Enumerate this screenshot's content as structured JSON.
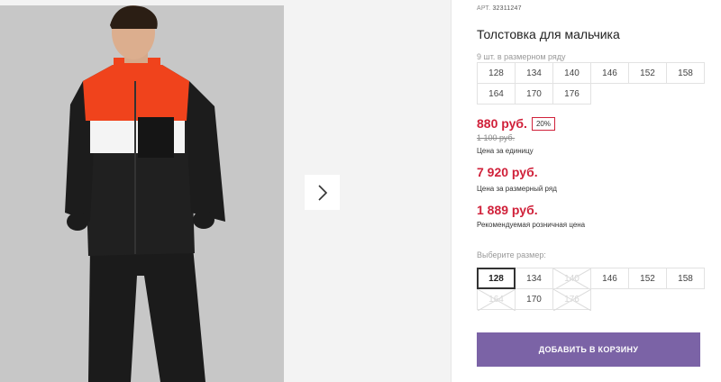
{
  "product": {
    "article_label": "АРТ.",
    "article_value": "32311247",
    "title": "Толстовка для мальчика",
    "pack_label": "9 шт. в размерном ряду"
  },
  "pack_sizes": [
    "128",
    "134",
    "140",
    "146",
    "152",
    "158",
    "164",
    "170",
    "176"
  ],
  "prices": {
    "unit_price": "880 руб.",
    "discount_badge": "20%",
    "old_price": "1 100 руб.",
    "unit_caption": "Цена за единицу",
    "pack_price": "7 920 руб.",
    "pack_caption": "Цена за размерный ряд",
    "retail_price": "1 889 руб.",
    "retail_caption": "Рекомендуемая розничная цена"
  },
  "size_selector": {
    "label": "Выберите размер:",
    "sizes": [
      {
        "label": "128",
        "state": "selected"
      },
      {
        "label": "134",
        "state": "available"
      },
      {
        "label": "140",
        "state": "unavailable"
      },
      {
        "label": "146",
        "state": "available"
      },
      {
        "label": "152",
        "state": "available"
      },
      {
        "label": "158",
        "state": "available"
      },
      {
        "label": "164",
        "state": "unavailable"
      },
      {
        "label": "170",
        "state": "available"
      },
      {
        "label": "176",
        "state": "unavailable"
      }
    ]
  },
  "cart": {
    "add_label": "ДОБАВИТЬ В КОРЗИНУ"
  },
  "colors": {
    "price_red": "#d0213a",
    "button_purple": "#7b63a6"
  },
  "icons": {
    "gallery_next": "chevron-right-icon",
    "unavailable": "cross-out"
  }
}
